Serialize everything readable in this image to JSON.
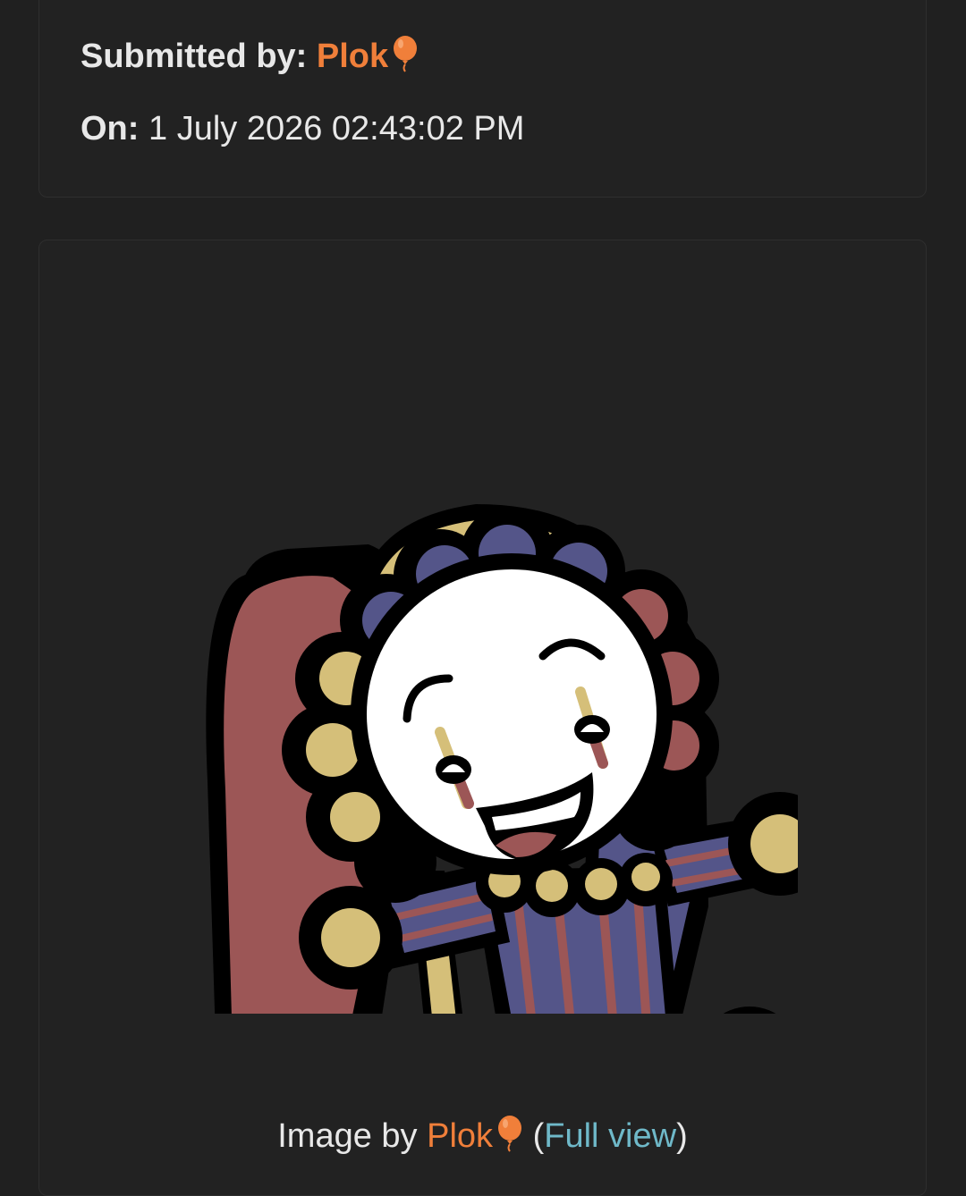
{
  "submission": {
    "submitted_label": "Submitted by:",
    "submitter": "Plok",
    "on_label": "On:",
    "date": "1 July 2026 02:43:02 PM"
  },
  "image_card": {
    "prefix": "Image by",
    "author": "Plok",
    "open_paren": "(",
    "full_view": "Full view",
    "close_paren": ")"
  },
  "icons": [
    "balloon-icon"
  ],
  "colors": {
    "background": "#202020",
    "card": "#222222",
    "username": "#f07f3a",
    "link": "#6fb9c9",
    "clown_red": "#9c5656",
    "clown_blue": "#545589",
    "clown_gold": "#d5bf79"
  }
}
